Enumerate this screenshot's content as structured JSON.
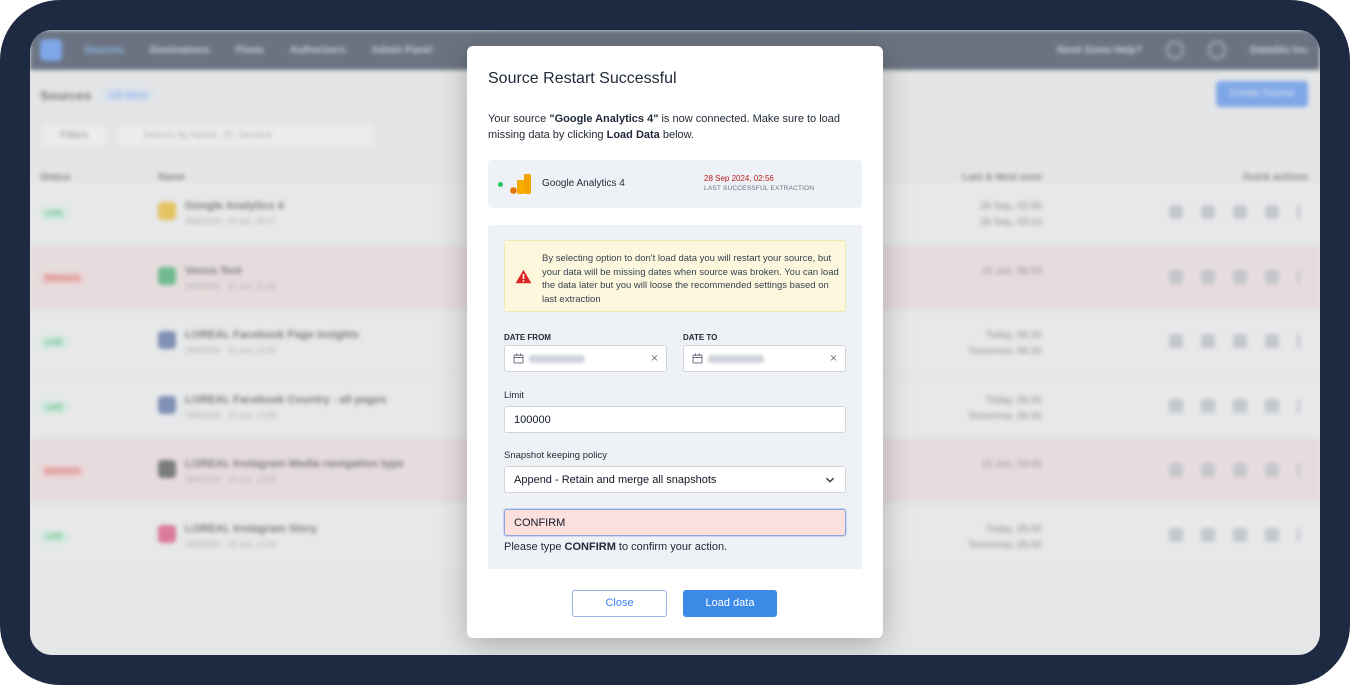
{
  "app": {
    "nav": [
      "Sources",
      "Destinations",
      "Flows",
      "Authorizers",
      "Admin Panel"
    ],
    "help": "Need Some Help?",
    "account": "Dataddo Inc.",
    "page_title": "Sources",
    "count": "136 items",
    "create_button": "Create Source",
    "filters": "Filters",
    "search_placeholder": "Search by Name, ID, Service",
    "headers": {
      "status": "Status",
      "name": "Name",
      "sync": "Last & Next sync",
      "actions": "Quick actions"
    },
    "rows": [
      {
        "status": "LIVE",
        "name": "Google Analytics 4",
        "sub": "28/9/2024 · 15 Jun, 09:17",
        "sync": [
          "28 Sep, 02:56",
          "28 Sep, 03:10"
        ],
        "icon_color": "#f4b400"
      },
      {
        "status": "BROKEN",
        "name": "Venca Test",
        "sub": "28/9/2024 · 15 Jun, 11:20",
        "sync": [
          "15 Jun, 08:03",
          "-"
        ],
        "icon_color": "#22a35a"
      },
      {
        "status": "LIVE",
        "name": "LOREAL Facebook Page Insights",
        "sub": "28/9/2024 · 15 Jun, 12:00",
        "sync": [
          "Today, 06:20",
          "Tomorrow, 06:20"
        ],
        "icon_color": "#3b5998"
      },
      {
        "status": "LIVE",
        "name": "LOREAL Facebook Country - all pages",
        "sub": "28/9/2024 · 15 Jun, 12:00",
        "sync": [
          "Today, 06:00",
          "Tomorrow, 06:00"
        ],
        "icon_color": "#3b5998"
      },
      {
        "status": "BROKEN",
        "name": "LOREAL Instagram Media navigation type",
        "sub": "28/9/2024 · 15 Jun, 12:00",
        "sync": [
          "15 Jun, 03:00",
          "-"
        ],
        "icon_color": "#333333"
      },
      {
        "status": "LIVE",
        "name": "LOREAL Instagram Story",
        "sub": "28/9/2024 · 15 Jun, 12:00",
        "sync": [
          "Today, 05:00",
          "Tomorrow, 05:00"
        ],
        "icon_color": "#e1306c"
      }
    ]
  },
  "modal": {
    "title": "Source Restart Successful",
    "desc_pre": "Your source ",
    "desc_source": "\"Google Analytics 4\"",
    "desc_mid": "  is now connected. Make sure to load missing data by clicking ",
    "desc_bold": "Load Data",
    "desc_post": " below.",
    "source_card": {
      "name": "Google Analytics 4",
      "date": "28 Sep 2024, 02:56",
      "label": "LAST SUCCESSFUL EXTRACTION"
    },
    "warning": "By selecting option to don't load data you will restart your source, but your data will be missing dates when source was broken. You can load the data later but you will loose the recommended settings based on last extraction",
    "date_from_label": "DATE FROM",
    "date_to_label": "DATE TO",
    "limit_label": "Limit",
    "limit_value": "100000",
    "snapshot_label": "Snapshot keeping policy",
    "snapshot_value": "Append - Retain and merge all snapshots",
    "confirm_value": "CONFIRM",
    "hint_pre": "Please type ",
    "hint_bold": "CONFIRM",
    "hint_post": " to confirm your action.",
    "close_button": "Close",
    "load_button": "Load data"
  },
  "colors": {
    "accent": "#3b8ae6",
    "frame": "#1e2a42",
    "warning_bg": "#fdf8dd",
    "danger": "#b91c1c",
    "success": "#22c55e"
  }
}
